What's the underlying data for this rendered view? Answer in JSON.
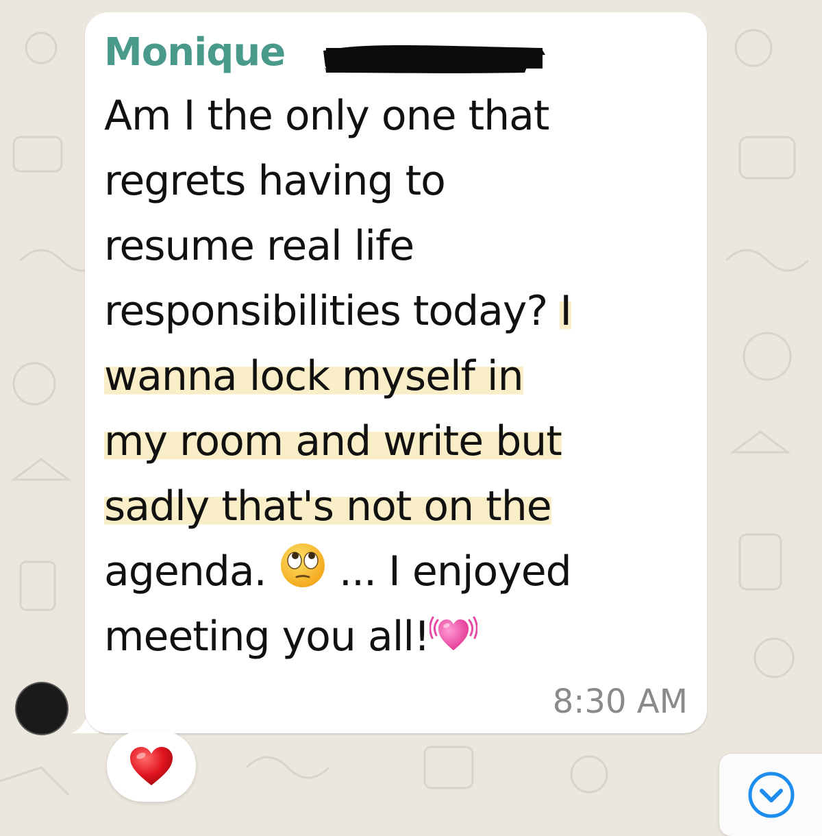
{
  "message": {
    "sender": "Monique",
    "lines": [
      {
        "parts": [
          {
            "text": "Am I the only one that"
          }
        ]
      },
      {
        "parts": [
          {
            "text": "regrets having to"
          }
        ]
      },
      {
        "parts": [
          {
            "text": "resume real life"
          }
        ]
      },
      {
        "parts": [
          {
            "text": "responsibilities today? "
          },
          {
            "text": "I",
            "highlight": true
          }
        ]
      },
      {
        "parts": [
          {
            "text": "wanna lock myself in",
            "highlight": true
          }
        ]
      },
      {
        "parts": [
          {
            "text": "my room and write but",
            "highlight": true
          }
        ]
      },
      {
        "parts": [
          {
            "text": "sadly that's not on the",
            "highlight": true
          }
        ]
      },
      {
        "parts": [
          {
            "text": "agenda. "
          },
          {
            "emoji": "face-with-rolling-eyes"
          },
          {
            "text": " ... I enjoyed"
          }
        ]
      },
      {
        "parts": [
          {
            "text": "meeting you all!"
          },
          {
            "emoji": "beating-heart"
          }
        ]
      }
    ],
    "time": "8:30 AM"
  },
  "reaction": {
    "emoji": "red-heart"
  },
  "scroll_down": {
    "icon": "chevron-down-icon"
  },
  "colors": {
    "sender_name": "#4a9a8c",
    "highlight": "#f8e9b6",
    "background": "#ebe6de",
    "bubble": "#ffffff",
    "timestamp": "#8a8a8a",
    "scroll_icon": "#1d8ef0"
  }
}
